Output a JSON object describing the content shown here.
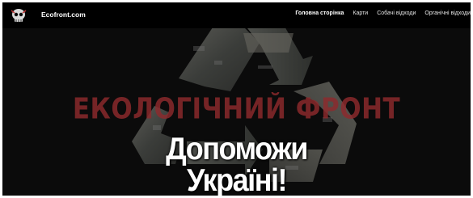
{
  "header": {
    "brand": "Ecofront.com",
    "logo_icon": "skull-logo-icon",
    "nav": [
      {
        "label": "Головна сторінка",
        "active": true
      },
      {
        "label": "Карти",
        "active": false
      },
      {
        "label": "Собачі відходи",
        "active": false
      },
      {
        "label": "Органічні відходи",
        "active": false
      }
    ]
  },
  "hero": {
    "background_icon": "recycle-symbol-icon",
    "headline": "ЕКОЛОГІЧНИЙ ФРОНТ",
    "cta_line1": "Допоможи",
    "cta_line2": "Україні!"
  },
  "colors": {
    "background": "#0b0b0b",
    "navbar": "#000000",
    "headline": "#8e2a2d",
    "text": "#ffffff"
  }
}
